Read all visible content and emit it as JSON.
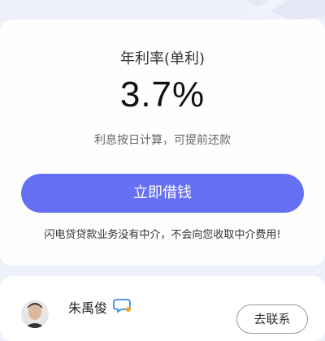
{
  "loan": {
    "rate_title": "年利率(单利)",
    "rate_value": "3.7%",
    "rate_desc": "利息按日计算，可提前还款",
    "borrow_button": "立即借钱",
    "notice": "闪电贷贷款业务没有中介，不会向您收取中介费用!"
  },
  "agent": {
    "name": "朱禹俊",
    "contact_button": "去联系",
    "chat_icon": "chat-bubble-icon"
  },
  "colors": {
    "primary": "#6570f4",
    "background": "#eef1f9"
  }
}
